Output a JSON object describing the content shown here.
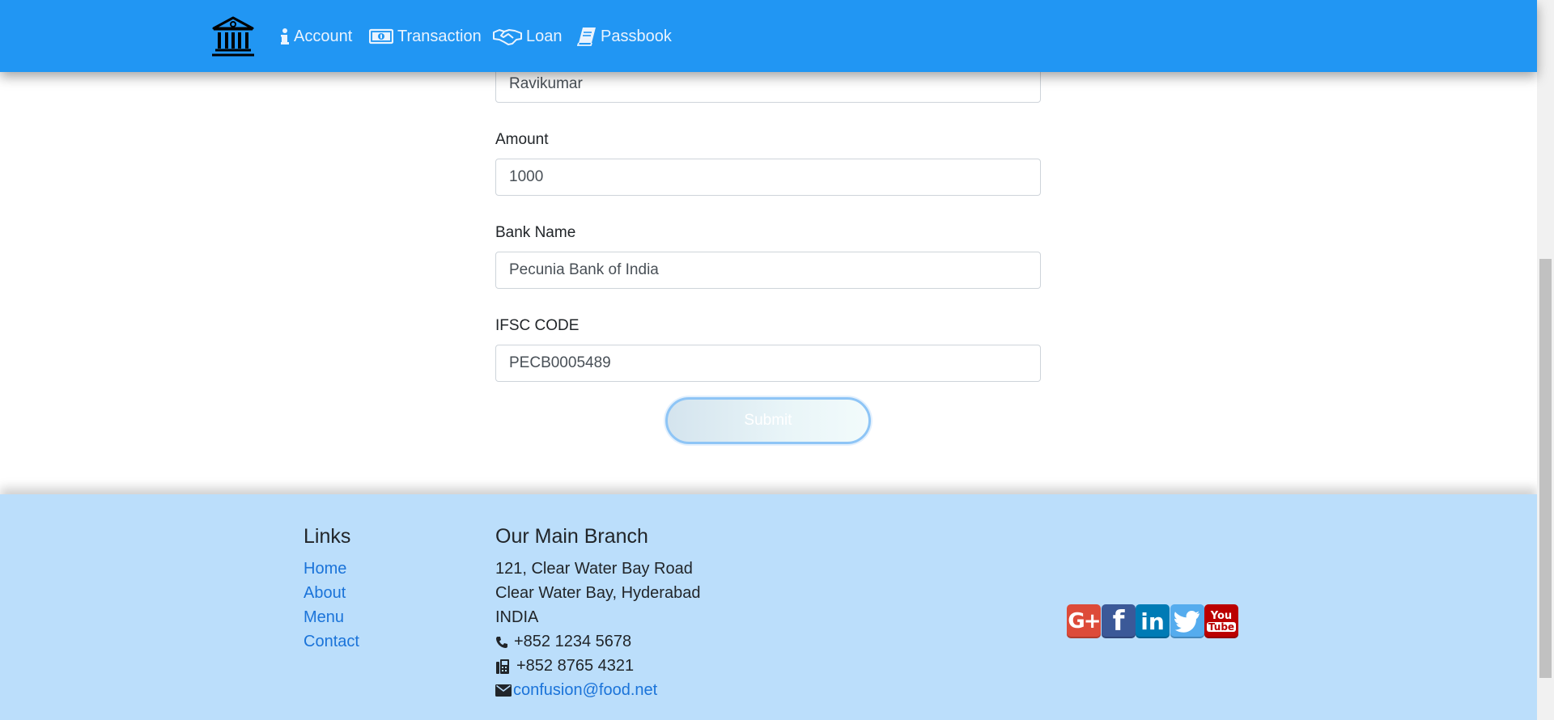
{
  "navbar": {
    "brand_icon": "bank-icon",
    "items": [
      {
        "label": "Account",
        "icon": "info-icon"
      },
      {
        "label": "Transaction",
        "icon": "money-bill-icon"
      },
      {
        "label": "Loan",
        "icon": "handshake-icon"
      },
      {
        "label": "Passbook",
        "icon": "book-icon"
      }
    ]
  },
  "form": {
    "name_value": "Ravikumar",
    "amount_label": "Amount",
    "amount_value": "1000",
    "bank_label": "Bank Name",
    "bank_value": "Pecunia Bank of India",
    "ifsc_label": "IFSC CODE",
    "ifsc_value": "PECB0005489",
    "submit_label": "Submit"
  },
  "footer": {
    "links_heading": "Links",
    "links": [
      "Home",
      "About",
      "Menu",
      "Contact"
    ],
    "branch_heading": "Our Main Branch",
    "address_lines": [
      "121, Clear Water Bay Road",
      "Clear Water Bay, Hyderabad",
      "INDIA"
    ],
    "phone": "+852 1234 5678",
    "fax": "+852 8765 4321",
    "email": "confusion@food.net",
    "social": [
      {
        "name": "google-plus",
        "icon": "google-plus-icon",
        "color": "#dd4b39"
      },
      {
        "name": "facebook",
        "icon": "facebook-icon",
        "color": "#3b5998"
      },
      {
        "name": "linkedin",
        "icon": "linkedin-icon",
        "color": "#007bb5"
      },
      {
        "name": "twitter",
        "icon": "twitter-icon",
        "color": "#55acee"
      },
      {
        "name": "youtube",
        "icon": "youtube-icon",
        "color": "#bb0000"
      }
    ]
  },
  "colors": {
    "navbar_bg": "#2196f3",
    "footer_bg": "#bbdefb",
    "link": "#1a73d9"
  }
}
